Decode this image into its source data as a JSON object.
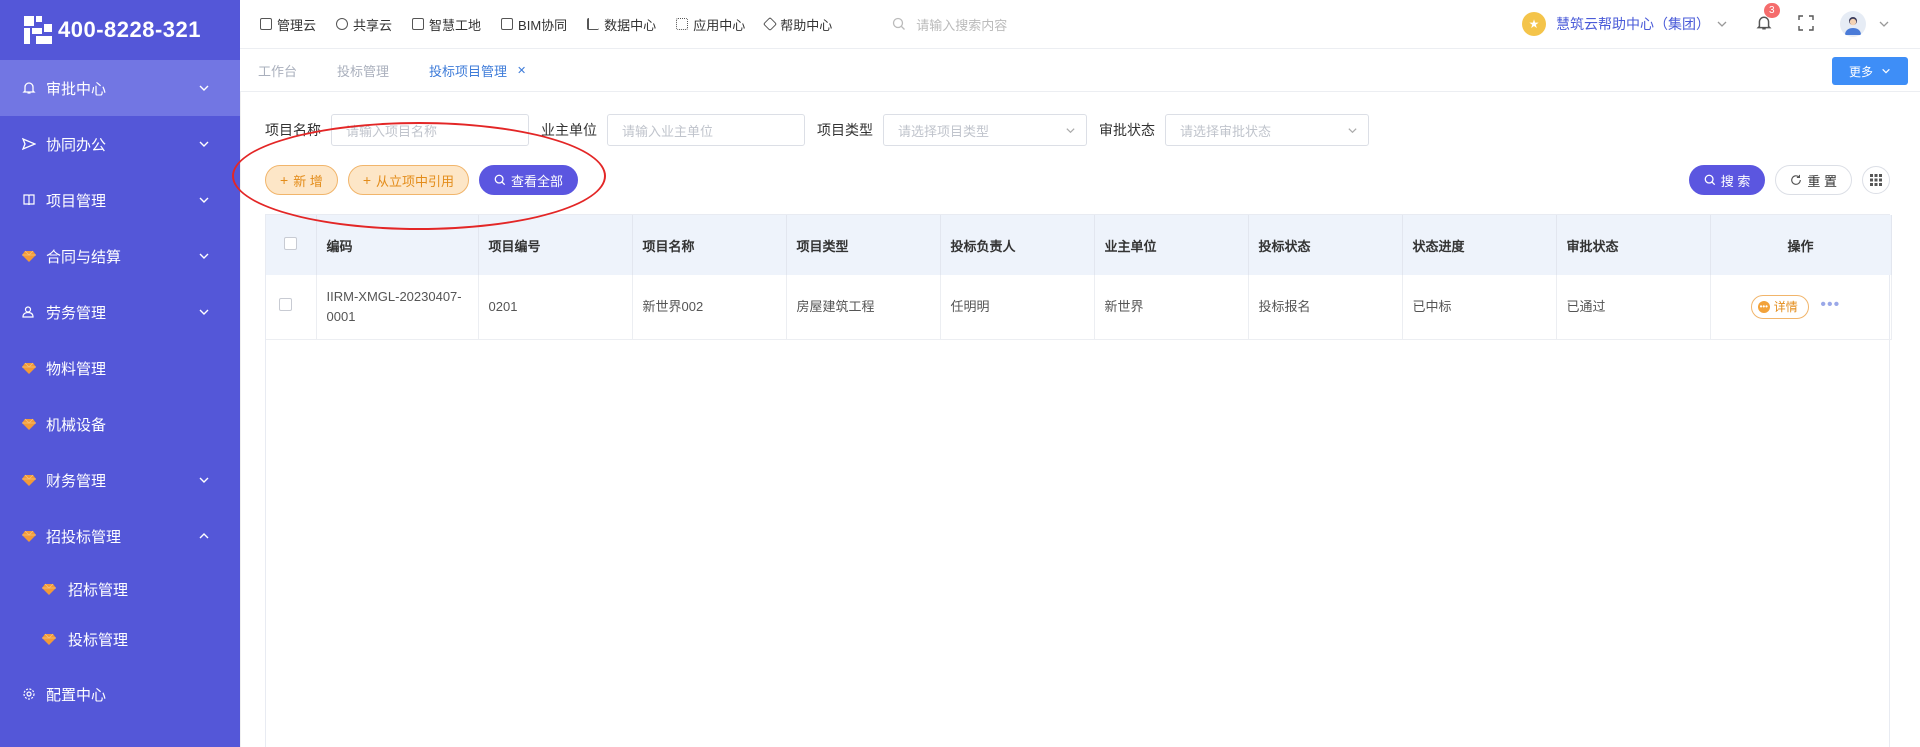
{
  "brand": {
    "phone": "400-8228-321"
  },
  "sidebar": {
    "items": [
      {
        "label": "审批中心",
        "icon": "bell-icon",
        "expandable": true,
        "expanded": false,
        "active": true
      },
      {
        "label": "协同办公",
        "icon": "send-icon",
        "expandable": true,
        "expanded": false
      },
      {
        "label": "项目管理",
        "icon": "book-icon",
        "expandable": true,
        "expanded": false
      },
      {
        "label": "合同与结算",
        "icon": "gem-icon",
        "expandable": true,
        "expanded": false
      },
      {
        "label": "劳务管理",
        "icon": "users-icon",
        "expandable": true,
        "expanded": false
      },
      {
        "label": "物料管理",
        "icon": "gem-icon",
        "expandable": false
      },
      {
        "label": "机械设备",
        "icon": "gem-icon",
        "expandable": false
      },
      {
        "label": "财务管理",
        "icon": "gem-icon",
        "expandable": true,
        "expanded": false
      },
      {
        "label": "招投标管理",
        "icon": "gem-icon",
        "expandable": true,
        "expanded": true
      }
    ],
    "subitems": [
      {
        "label": "招标管理",
        "icon": "gem-icon"
      },
      {
        "label": "投标管理",
        "icon": "gem-icon"
      }
    ],
    "footer_item": {
      "label": "配置中心",
      "icon": "gear-icon"
    }
  },
  "topbar": {
    "links": [
      "管理云",
      "共享云",
      "智慧工地",
      "BIM协同",
      "数据中心",
      "应用中心",
      "帮助中心"
    ],
    "search_placeholder": "请输入搜索内容",
    "org_name": "慧筑云帮助中心（集团）",
    "notification_count": "3"
  },
  "tabs": [
    {
      "label": "工作台",
      "active": false
    },
    {
      "label": "投标管理",
      "active": false
    },
    {
      "label": "投标项目管理",
      "active": true,
      "closable": true
    }
  ],
  "more_label": "更多",
  "filters": [
    {
      "label": "项目名称",
      "placeholder": "请输入项目名称",
      "type": "input"
    },
    {
      "label": "业主单位",
      "placeholder": "请输入业主单位",
      "type": "input"
    },
    {
      "label": "项目类型",
      "placeholder": "请选择项目类型",
      "type": "select"
    },
    {
      "label": "审批状态",
      "placeholder": "请选择审批状态",
      "type": "select"
    }
  ],
  "actions": {
    "add": "新 增",
    "import": "从立项中引用",
    "view_all": "查看全部",
    "search": "搜 索",
    "reset": "重 置"
  },
  "table": {
    "columns": [
      "编码",
      "项目编号",
      "项目名称",
      "项目类型",
      "投标负责人",
      "业主单位",
      "投标状态",
      "状态进度",
      "审批状态",
      "操作"
    ],
    "rows": [
      {
        "code": "IIRM-XMGL-20230407-0001",
        "project_no": "0201",
        "project_name": "新世界002",
        "project_type": "房屋建筑工程",
        "owner": "任明明",
        "owner_unit": "新世界",
        "bid_status": "投标报名",
        "progress": "已中标",
        "approval": "已通过",
        "detail_label": "详情"
      }
    ]
  },
  "colors": {
    "sidebar": "#5457d8",
    "accent": "#5b56e0",
    "orange": "#e38c1a",
    "annotation": "#e32626"
  }
}
